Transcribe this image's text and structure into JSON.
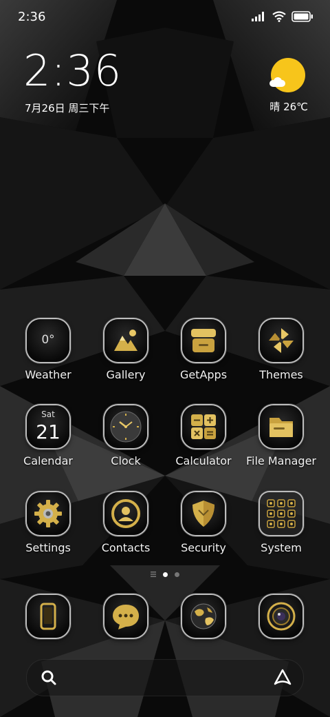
{
  "status_bar": {
    "time": "2:36"
  },
  "clock_widget": {
    "time": "2:36",
    "date": "7月26日 周三下午"
  },
  "weather_widget": {
    "text": "晴 26℃"
  },
  "apps": [
    {
      "label": "Weather",
      "icon": "weather-icon",
      "badge": "0°"
    },
    {
      "label": "Gallery",
      "icon": "gallery-icon"
    },
    {
      "label": "GetApps",
      "icon": "getapps-store-icon"
    },
    {
      "label": "Themes",
      "icon": "themes-pinwheel-icon"
    },
    {
      "label": "Calendar",
      "icon": "calendar-icon",
      "day": "Sat",
      "date": "21"
    },
    {
      "label": "Clock",
      "icon": "clock-icon"
    },
    {
      "label": "Calculator",
      "icon": "calculator-icon"
    },
    {
      "label": "File Manager",
      "icon": "folder-icon"
    },
    {
      "label": "Settings",
      "icon": "gear-icon"
    },
    {
      "label": "Contacts",
      "icon": "contact-person-icon"
    },
    {
      "label": "Security",
      "icon": "shield-icon"
    },
    {
      "label": "System",
      "icon": "folder-grid-icon"
    }
  ],
  "dock": [
    {
      "icon": "phone-icon"
    },
    {
      "icon": "message-bubble-icon"
    },
    {
      "icon": "browser-globe-icon"
    },
    {
      "icon": "camera-lens-icon"
    }
  ],
  "page_indicator": {
    "pages": 2,
    "current": 1
  },
  "colors": {
    "gold": "#d4b04a",
    "sun": "#f7c51b",
    "background": "#0b0b0b"
  }
}
